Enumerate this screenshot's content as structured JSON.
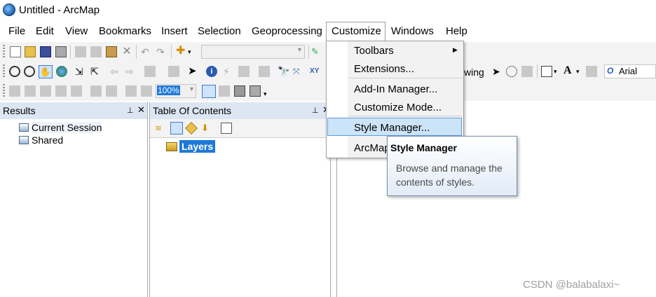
{
  "window": {
    "title": "Untitled - ArcMap"
  },
  "menubar": {
    "items": [
      "File",
      "Edit",
      "View",
      "Bookmarks",
      "Insert",
      "Selection",
      "Geoprocessing",
      "Customize",
      "Windows",
      "Help"
    ],
    "active": "Customize"
  },
  "toolbar": {
    "scale_value": "",
    "zoom_value": "100%",
    "drawing_label": "wing",
    "font_value": "Arial"
  },
  "results_panel": {
    "title": "Results",
    "items": [
      "Current Session",
      "Shared"
    ]
  },
  "toc_panel": {
    "title": "Table Of Contents",
    "root_label": "Layers"
  },
  "customize_menu": {
    "items": [
      "Toolbars",
      "Extensions...",
      "Add-In Manager...",
      "Customize Mode...",
      "Style Manager...",
      "ArcMap"
    ],
    "highlighted": "Style Manager..."
  },
  "tooltip": {
    "title": "Style Manager",
    "body": "Browse and manage the contents of styles."
  },
  "watermark": "CSDN @balabalaxi~"
}
